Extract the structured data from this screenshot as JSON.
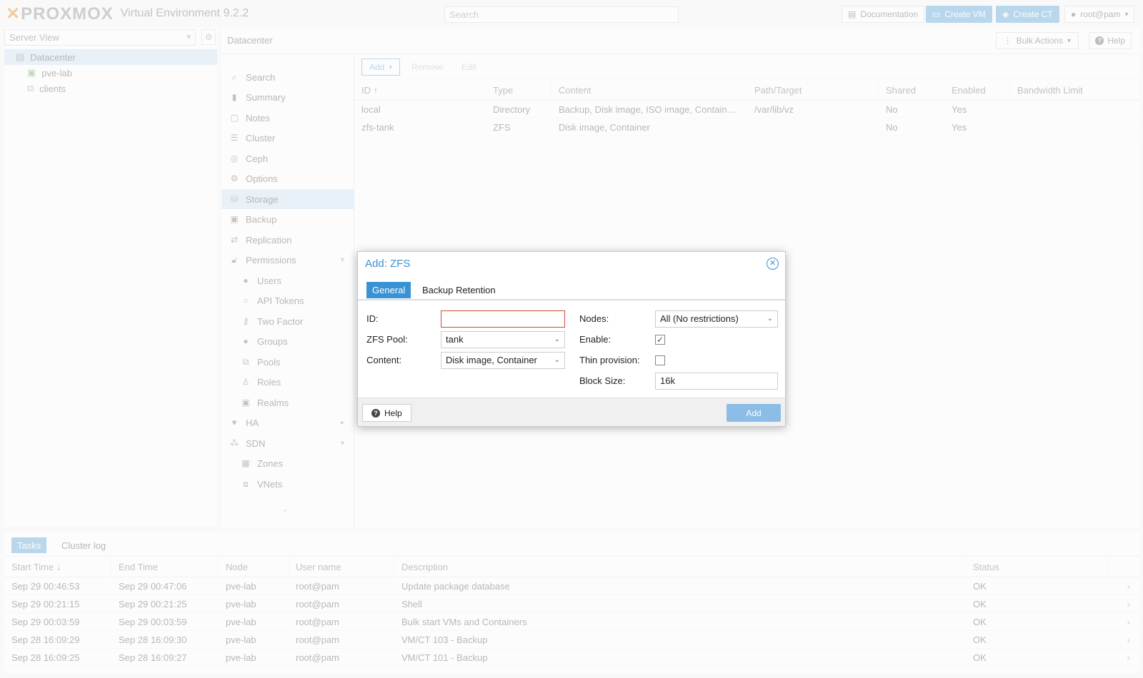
{
  "header": {
    "brand": "PROXMOX",
    "version": "Virtual Environment 9.2.2",
    "search_placeholder": "Search",
    "documentation": "Documentation",
    "create_vm": "Create VM",
    "create_ct": "Create CT",
    "user": "root@pam"
  },
  "tree": {
    "view": "Server View",
    "items": [
      "Datacenter",
      "pve-lab",
      "clients"
    ]
  },
  "content": {
    "title": "Datacenter",
    "bulk_actions": "Bulk Actions",
    "help": "Help"
  },
  "nav": {
    "items": [
      "Search",
      "Summary",
      "Notes",
      "Cluster",
      "Ceph",
      "Options",
      "Storage",
      "Backup",
      "Replication",
      "Permissions",
      "Users",
      "API Tokens",
      "Two Factor",
      "Groups",
      "Pools",
      "Roles",
      "Realms",
      "HA",
      "SDN",
      "Zones",
      "VNets"
    ]
  },
  "storage": {
    "toolbar": {
      "add": "Add",
      "remove": "Remove",
      "edit": "Edit"
    },
    "columns": [
      "ID",
      "Type",
      "Content",
      "Path/Target",
      "Shared",
      "Enabled",
      "Bandwidth Limit"
    ],
    "rows": [
      [
        "local",
        "Directory",
        "Backup, Disk image, ISO image, Contain…",
        "/var/lib/vz",
        "No",
        "Yes",
        ""
      ],
      [
        "zfs-tank",
        "ZFS",
        "Disk image, Container",
        "",
        "No",
        "Yes",
        ""
      ]
    ]
  },
  "bottom": {
    "tabs": [
      "Tasks",
      "Cluster log"
    ],
    "columns": [
      "Start Time",
      "End Time",
      "Node",
      "User name",
      "Description",
      "Status"
    ],
    "rows": [
      [
        "Sep 29 00:46:53",
        "Sep 29 00:47:06",
        "pve-lab",
        "root@pam",
        "Update package database",
        "OK"
      ],
      [
        "Sep 29 00:21:15",
        "Sep 29 00:21:25",
        "pve-lab",
        "root@pam",
        "Shell",
        "OK"
      ],
      [
        "Sep 29 00:03:59",
        "Sep 29 00:03:59",
        "pve-lab",
        "root@pam",
        "Bulk start VMs and Containers",
        "OK"
      ],
      [
        "Sep 28 16:09:29",
        "Sep 28 16:09:30",
        "pve-lab",
        "root@pam",
        "VM/CT 103 - Backup",
        "OK"
      ],
      [
        "Sep 28 16:09:25",
        "Sep 28 16:09:27",
        "pve-lab",
        "root@pam",
        "VM/CT 101 - Backup",
        "OK"
      ]
    ]
  },
  "dialog": {
    "title": "Add: ZFS",
    "tabs": [
      "General",
      "Backup Retention"
    ],
    "labels": {
      "id": "ID:",
      "zfs_pool": "ZFS Pool:",
      "content": "Content:",
      "nodes": "Nodes:",
      "enable": "Enable:",
      "thin": "Thin provision:",
      "block_size": "Block Size:"
    },
    "values": {
      "id": "",
      "zfs_pool": "tank",
      "content": "Disk image, Container",
      "nodes": "All (No restrictions)",
      "enable": true,
      "thin": false,
      "block_size": "16k"
    },
    "help": "Help",
    "add": "Add"
  }
}
